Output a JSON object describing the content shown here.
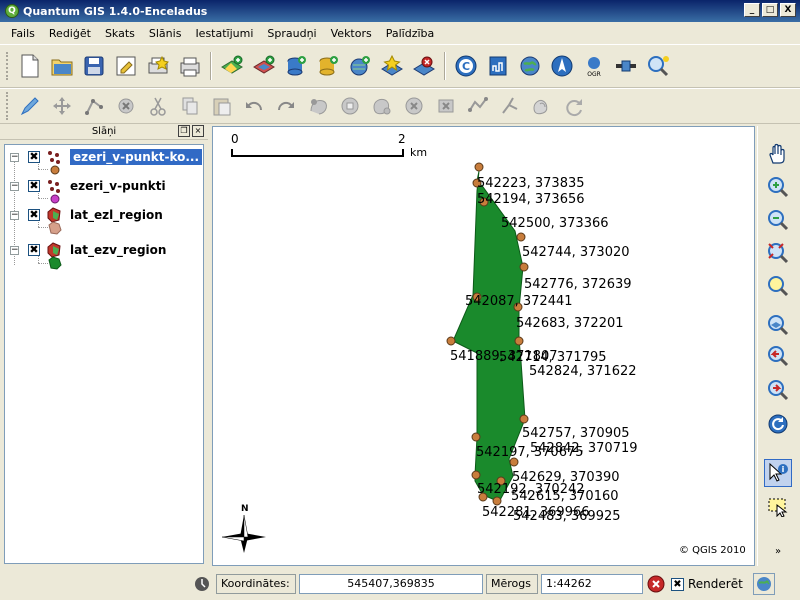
{
  "window": {
    "title": "Quantum GIS 1.4.0-Enceladus",
    "min": "_",
    "max": "□",
    "close": "X"
  },
  "menu": [
    "Fails",
    "Rediģēt",
    "Skats",
    "Slānis",
    "Iestatījumi",
    "Spraudņi",
    "Vektors",
    "Palīdzība"
  ],
  "layers_panel": {
    "title": "Slāņi",
    "float_btn": "❐",
    "close_btn": "×",
    "layers": [
      {
        "name": "ezeri_v-punkt-ko...",
        "checked": "✖",
        "expander": "−"
      },
      {
        "name": "ezeri_v-punkti",
        "checked": "✖",
        "expander": "−"
      },
      {
        "name": "lat_ezl_region",
        "checked": "✖",
        "expander": "−"
      },
      {
        "name": "lat_ezv_region",
        "checked": "✖",
        "expander": "−"
      }
    ]
  },
  "map": {
    "scalebar": {
      "start": "0",
      "end": "2",
      "unit": "km"
    },
    "north": "N",
    "copyright": "© QGIS 2010",
    "fill_color": "#1a8a2c",
    "point_color": "#c87d3c",
    "labels": [
      "542223, 373835",
      "542194, 373656",
      "542500, 373366",
      "542744, 373020",
      "542776, 372639",
      "542087, 372441",
      "542683, 372201",
      "541889, 371807",
      "542714, 371795",
      "542824, 371622",
      "542757, 370905",
      "542197, 370675",
      "542842, 370719",
      "542629, 370390",
      "542192, 370242",
      "542615, 370160",
      "542281, 369966",
      "542483, 369925"
    ]
  },
  "statusbar": {
    "coords_label": "Koordinātes:",
    "coords_value": "545407,369835",
    "scale_label": "Mērogs",
    "scale_value": "1:44262",
    "render_label": "Renderēt",
    "render_check": "✖"
  }
}
